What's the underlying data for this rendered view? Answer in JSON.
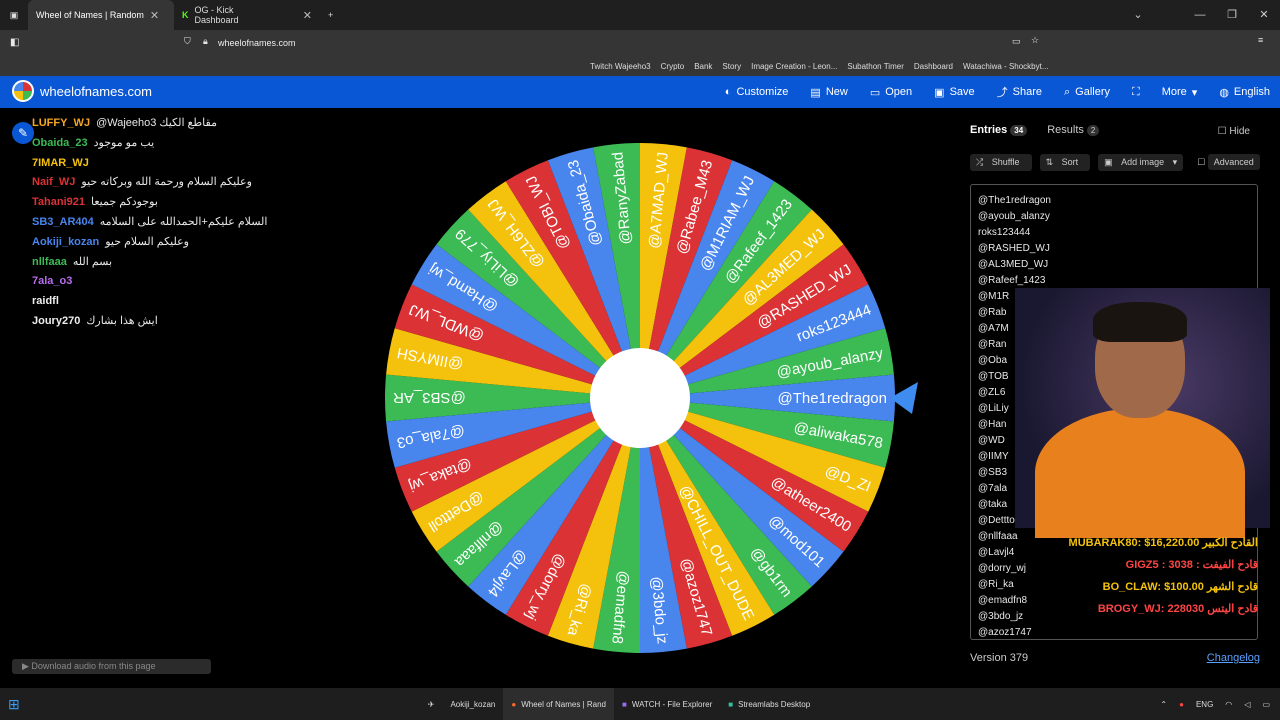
{
  "browser": {
    "tabs": [
      {
        "title": "Wheel of Names | Random",
        "active": true
      },
      {
        "title": "OG - Kick Dashboard",
        "active": false
      }
    ],
    "url": "wheelofnames.com",
    "bookmarks": [
      "Twitch Wajeeho3",
      "Crypto",
      "Bank",
      "Story",
      "Image Creation - Leon...",
      "Subathon Timer",
      "Dashboard",
      "Watachiwa - Shockbyt..."
    ]
  },
  "site": {
    "logo": "wheelofnames.com",
    "nav": [
      "Customize",
      "New",
      "Open",
      "Save",
      "Share",
      "Gallery",
      "More",
      "English"
    ]
  },
  "chat": [
    {
      "user": "LUFFY_WJ",
      "color": "#f5a623",
      "msg": "@Wajeeho3 مقاطع الكيك"
    },
    {
      "user": "Obaida_23",
      "color": "#3cba54",
      "msg": "يب مو موجود"
    },
    {
      "user": "7IMAR_WJ",
      "color": "#f4c20d",
      "msg": ""
    },
    {
      "user": "Naif_WJ",
      "color": "#db3236",
      "msg": "وعليكم السلام ورحمة الله وبركاته حيو"
    },
    {
      "user": "Tahani921",
      "color": "#db3236",
      "msg": "بوجودكم جميعا"
    },
    {
      "user": "SB3_AR404",
      "color": "#4885ed",
      "msg": "السلام عليكم+الحمدالله على السلامه"
    },
    {
      "user": "Aokiji_kozan",
      "color": "#4885ed",
      "msg": "وعليكم السلام حيو"
    },
    {
      "user": "nllfaaa",
      "color": "#3cba54",
      "msg": "بسم الله"
    },
    {
      "user": "7ala_o3",
      "color": "#b86cf0",
      "msg": ""
    },
    {
      "user": "raidfl",
      "color": "#eeeeee",
      "msg": ""
    },
    {
      "user": "Joury270",
      "color": "#eeeeee",
      "msg": "ايش هذا بشارك"
    }
  ],
  "download_audio": "Download audio from this page",
  "wheel": {
    "colors": [
      "#4885ed",
      "#3cba54",
      "#f4c20d",
      "#db3236"
    ],
    "pointer_color": "#3f8cf0",
    "labels": [
      "@The1redragon",
      "@aliwaka578",
      "@D_ZI",
      "@atheer2400",
      "@mod101",
      "@gb1rm",
      "@CHILL_OUT_DUDE",
      "@azoz1747",
      "@3bdo_jz",
      "@emadfn8",
      "@Ri_ka",
      "@dorry_wj",
      "@Lavjl4",
      "@nllfaaa",
      "@Detttoll",
      "@taka_wj",
      "@7ala_o3",
      "@SB3_AR",
      "@IIMYSH",
      "@WDL_WJ",
      "@Hamd_wj",
      "@LiLiy_779",
      "@ZL6H_WJ",
      "@TOBI_WJ",
      "@Obaida_23",
      "@RanyZabad",
      "@A7MAD_WJ",
      "@Rabee_M43",
      "@M1RIAM_WJ",
      "@Rafeef_1423",
      "@AL3MED_WJ",
      "@RASHED_WJ",
      "roks123444",
      "@ayoub_alanzy"
    ]
  },
  "panel": {
    "tab_entries": "Entries",
    "entries_count": "34",
    "tab_results": "Results",
    "results_count": "2",
    "hide": "Hide",
    "shuffle": "Shuffle",
    "sort": "Sort",
    "add_image": "Add image",
    "advanced": "Advanced",
    "entries": [
      "@The1redragon",
      "@ayoub_alanzy",
      "roks123444",
      "@RASHED_WJ",
      "@AL3MED_WJ",
      "@Rafeef_1423",
      "@M1R",
      "@Rab",
      "@A7M",
      "@Ran",
      "@Oba",
      "@TOB",
      "@ZL6",
      "@LiLiy",
      "@Han",
      "@WD",
      "@IIMY",
      "@SB3",
      "@7ala",
      "@taka",
      "@Detttoll",
      "@nllfaaa",
      "@Lavjl4",
      "@dorry_wj",
      "@Ri_ka",
      "@emadfn8",
      "@3bdo_jz",
      "@azoz1747"
    ],
    "version": "Version 379",
    "changelog": "Changelog"
  },
  "overlay": [
    {
      "text": "MUBARAK80: $16,220.00 القادح الكبير",
      "color": "#f4c20d"
    },
    {
      "text": "GIGZ5 : 3038 : قادح الفيفت",
      "color": "#ff4444"
    },
    {
      "text": "BO_CLAW: $100.00 قادح الشهر",
      "color": "#f4c20d"
    },
    {
      "text": "BROGY_WJ: 228030 قادح اليتس",
      "color": "#ff4444"
    }
  ],
  "taskbar": [
    "Aokiji_kozan",
    "Wheel of Names | Rand",
    "WATCH - File Explorer",
    "Streamlabs Desktop"
  ],
  "tray": [
    "ENG"
  ]
}
